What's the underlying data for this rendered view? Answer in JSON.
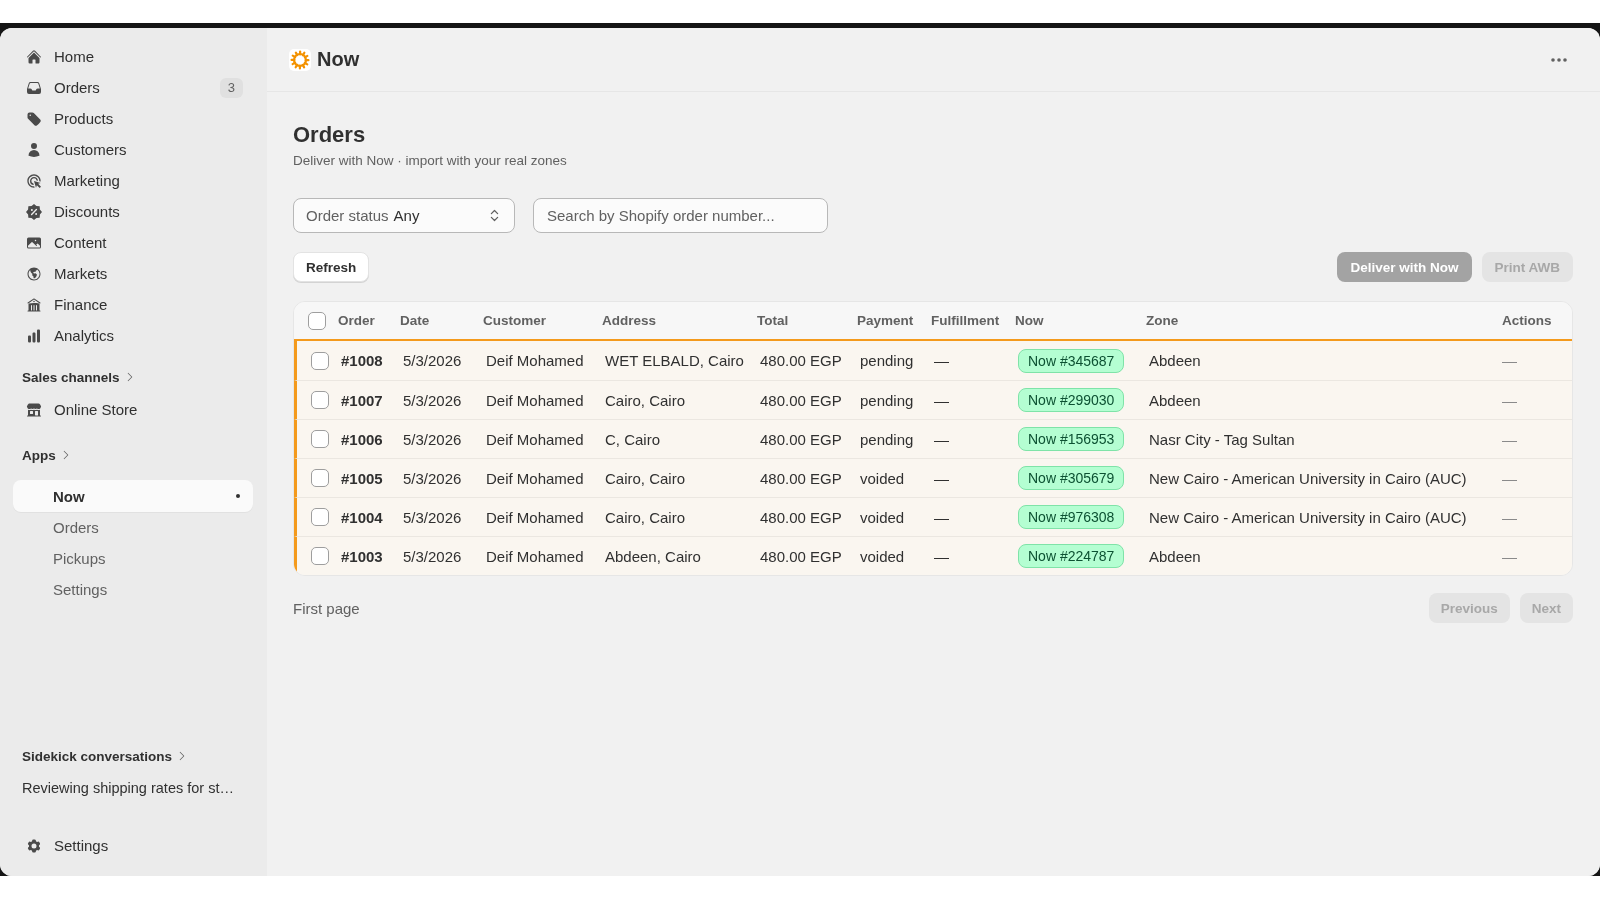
{
  "sidebar": {
    "nav": [
      {
        "label": "Home",
        "selected": false
      },
      {
        "label": "Orders",
        "badge": "3",
        "selected": false
      },
      {
        "label": "Products",
        "selected": false
      },
      {
        "label": "Customers",
        "selected": false
      },
      {
        "label": "Marketing",
        "selected": false
      },
      {
        "label": "Discounts",
        "selected": false
      },
      {
        "label": "Content",
        "selected": false
      },
      {
        "label": "Markets",
        "selected": false
      },
      {
        "label": "Finance",
        "selected": false
      },
      {
        "label": "Analytics",
        "selected": false
      }
    ],
    "sales_channels": {
      "heading": "Sales channels",
      "items": [
        {
          "label": "Online Store",
          "selected": false
        }
      ]
    },
    "apps": {
      "heading": "Apps",
      "items": [
        {
          "label": "Now",
          "selected": true,
          "dot": true,
          "children": [
            {
              "label": "Orders",
              "selected": false
            },
            {
              "label": "Pickups",
              "selected": false
            },
            {
              "label": "Settings",
              "selected": false
            }
          ]
        }
      ]
    },
    "sidekick": {
      "heading": "Sidekick conversations",
      "items": [
        {
          "label": "Reviewing shipping rates for st…"
        }
      ]
    },
    "footer": {
      "label": "Settings",
      "selected": false
    }
  },
  "app_header": {
    "title": "Now"
  },
  "page": {
    "title": "Orders",
    "subtitle": "Deliver with Now · import with your real zones"
  },
  "filters": {
    "status": {
      "label": "Order status",
      "value": "Any"
    },
    "search": {
      "placeholder": "Search by Shopify order number..."
    }
  },
  "toolbar": {
    "refresh": {
      "label": "Refresh"
    },
    "actions": [
      {
        "label": "Deliver with Now",
        "kind": "primary",
        "disabled": true
      },
      {
        "label": "Print AWB",
        "kind": "secondary",
        "disabled": true
      }
    ]
  },
  "table": {
    "select_all": {
      "checked": false
    },
    "columns": [
      "Order",
      "Date",
      "Customer",
      "Address",
      "Total",
      "Payment",
      "Fulfillment",
      "Now",
      "Zone",
      "Actions"
    ],
    "rows": [
      {
        "selected": false,
        "highlighted": true,
        "order": "#1008",
        "date": "5/3/2026",
        "customer": "Deif Mohamed",
        "address": "WET ELBALD, Cairo",
        "total": "480.00 EGP",
        "payment": "pending",
        "fulfillment": "—",
        "now": "Now #345687",
        "zone": "Abdeen",
        "actions": "—"
      },
      {
        "selected": false,
        "highlighted": true,
        "order": "#1007",
        "date": "5/3/2026",
        "customer": "Deif Mohamed",
        "address": "Cairo, Cairo",
        "total": "480.00 EGP",
        "payment": "pending",
        "fulfillment": "—",
        "now": "Now #299030",
        "zone": "Abdeen",
        "actions": "—"
      },
      {
        "selected": false,
        "highlighted": true,
        "order": "#1006",
        "date": "5/3/2026",
        "customer": "Deif Mohamed",
        "address": "C, Cairo",
        "total": "480.00 EGP",
        "payment": "pending",
        "fulfillment": "—",
        "now": "Now #156953",
        "zone": "Nasr City - Tag Sultan",
        "actions": "—"
      },
      {
        "selected": false,
        "highlighted": true,
        "order": "#1005",
        "date": "5/3/2026",
        "customer": "Deif Mohamed",
        "address": "Cairo, Cairo",
        "total": "480.00 EGP",
        "payment": "voided",
        "fulfillment": "—",
        "now": "Now #305679",
        "zone": "New Cairo - American University in Cairo (AUC)",
        "actions": "—"
      },
      {
        "selected": false,
        "highlighted": true,
        "order": "#1004",
        "date": "5/3/2026",
        "customer": "Deif Mohamed",
        "address": "Cairo, Cairo",
        "total": "480.00 EGP",
        "payment": "voided",
        "fulfillment": "—",
        "now": "Now #976308",
        "zone": "New Cairo - American University in Cairo (AUC)",
        "actions": "—"
      },
      {
        "selected": false,
        "highlighted": true,
        "order": "#1003",
        "date": "5/3/2026",
        "customer": "Deif Mohamed",
        "address": "Abdeen, Cairo",
        "total": "480.00 EGP",
        "payment": "voided",
        "fulfillment": "—",
        "now": "Now #224787",
        "zone": "Abdeen",
        "actions": "—"
      }
    ]
  },
  "pagination": {
    "label": "First page",
    "buttons": [
      {
        "label": "Previous",
        "disabled": true
      },
      {
        "label": "Next",
        "disabled": true
      }
    ]
  }
}
